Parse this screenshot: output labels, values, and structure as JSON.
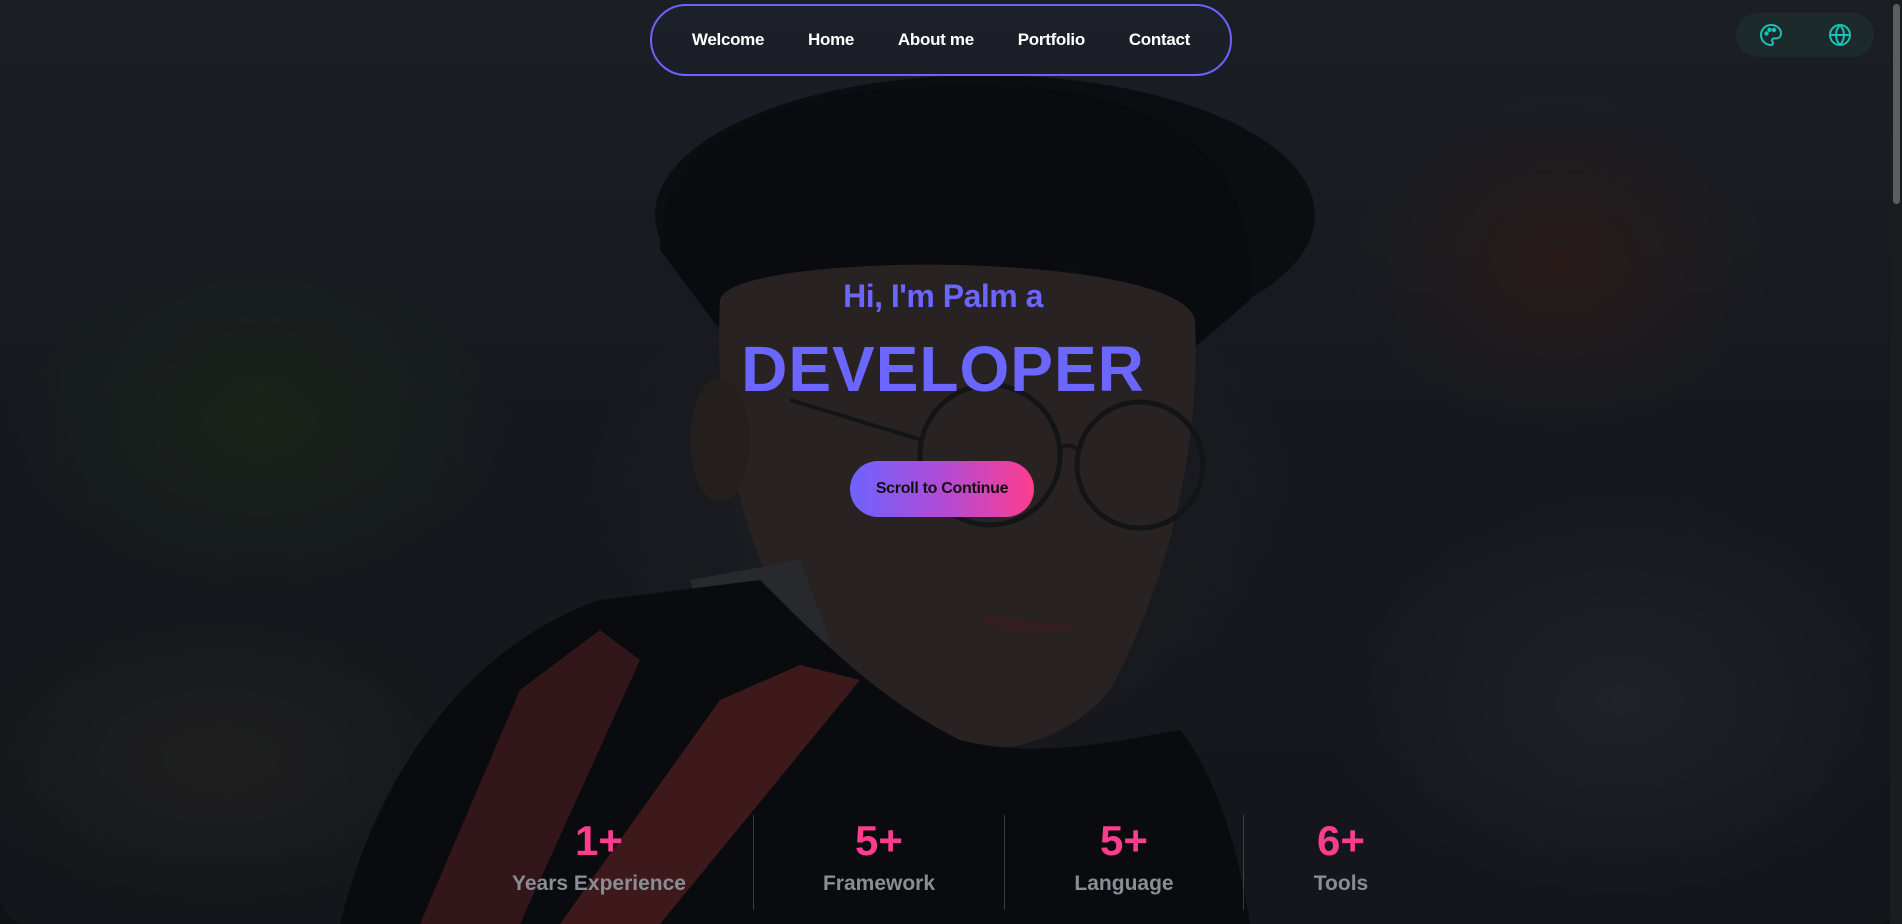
{
  "nav": {
    "items": [
      {
        "label": "Welcome"
      },
      {
        "label": "Home"
      },
      {
        "label": "About me"
      },
      {
        "label": "Portfolio"
      },
      {
        "label": "Contact"
      }
    ],
    "border_color": "#6b63ff"
  },
  "tools": {
    "theme_icon": "palette-icon",
    "language_icon": "globe-icon",
    "icon_color": "#19c3b3"
  },
  "hero": {
    "greeting": "Hi, I'm Palm a",
    "role": "DEVELOPER",
    "cta_label": "Scroll to Continue",
    "accent": "#6a66ff",
    "cta_gradient": [
      "#6e63ff",
      "#ff3d8f"
    ]
  },
  "stats": [
    {
      "value": "1+",
      "label": "Years Experience"
    },
    {
      "value": "5+",
      "label": "Framework"
    },
    {
      "value": "5+",
      "label": "Language"
    },
    {
      "value": "6+",
      "label": "Tools"
    }
  ],
  "stat_value_color": "#ff3d8f"
}
